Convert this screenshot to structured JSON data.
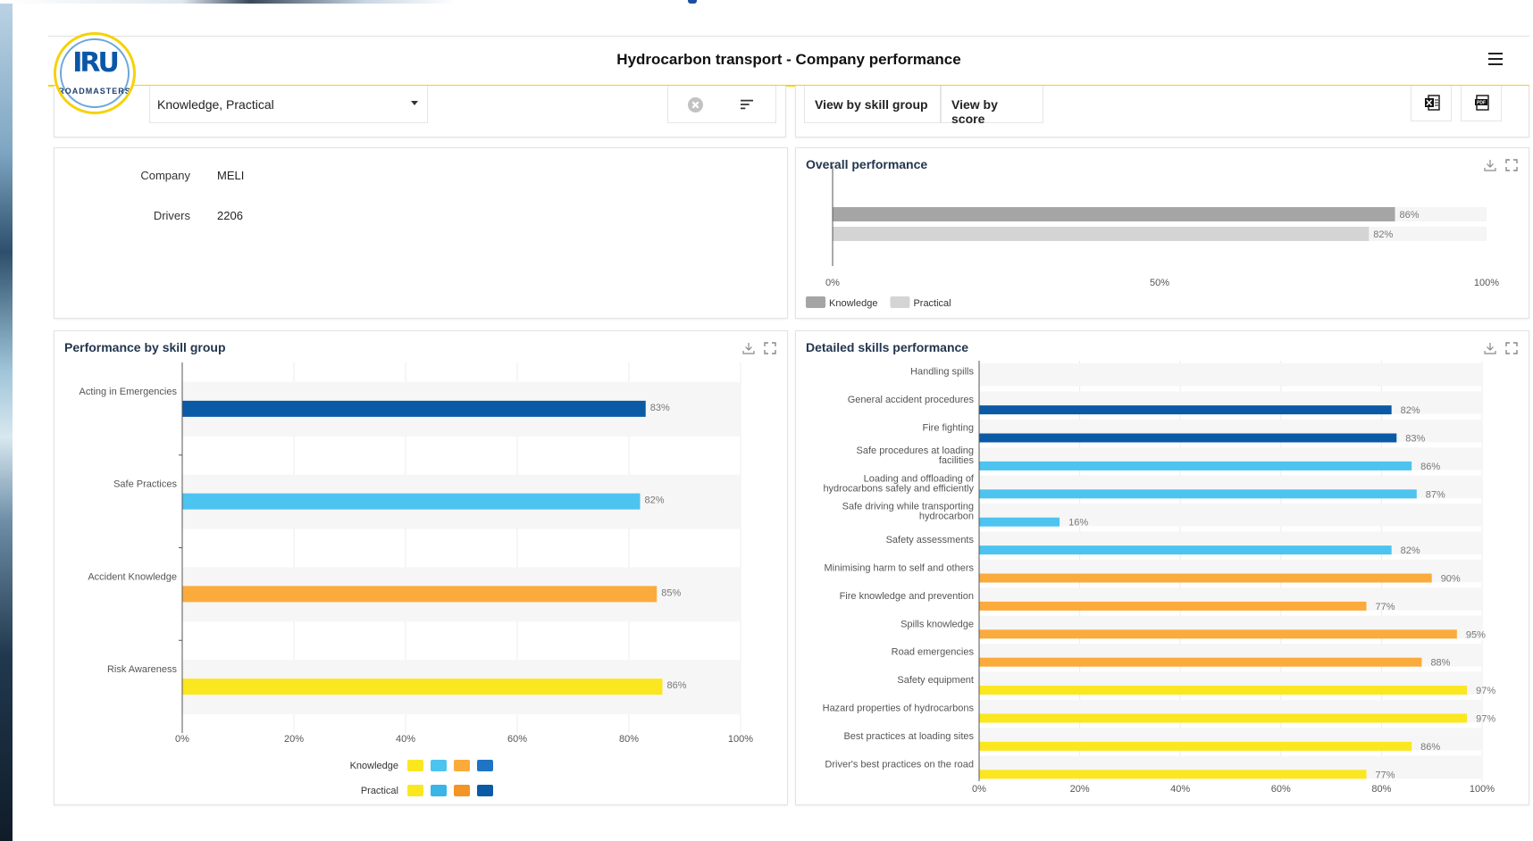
{
  "header": {
    "title": "Hydrocarbon transport - Company performance"
  },
  "logo": {
    "text": "IRU",
    "sub": "ROADMASTERS"
  },
  "filters": {
    "select_value": "Knowledge, Practical",
    "view_by_skill_group": "View by skill group",
    "view_by_score": "View by score",
    "export_xls_icon": "excel-icon",
    "export_pdf_icon": "pdf-icon"
  },
  "info": {
    "company_label": "Company",
    "company_value": "MELI",
    "drivers_label": "Drivers",
    "drivers_value": "2206"
  },
  "overall": {
    "title": "Overall performance",
    "chart_data": {
      "type": "bar",
      "orientation": "horizontal",
      "series": [
        {
          "name": "Knowledge",
          "value": 86,
          "label": "86%",
          "color": "#a5a5a5"
        },
        {
          "name": "Practical",
          "value": 82,
          "label": "82%",
          "color": "#d4d4d4"
        }
      ],
      "ticks": [
        "0%",
        "50%",
        "100%"
      ],
      "xlim": [
        0,
        100
      ]
    }
  },
  "skill_group": {
    "title": "Performance by skill group",
    "chart_data": {
      "type": "bar",
      "orientation": "horizontal",
      "categories": [
        "Acting in Emergencies",
        "Safe Practices",
        "Accident Knowledge",
        "Risk Awareness"
      ],
      "values": [
        83,
        82,
        85,
        86
      ],
      "labels": [
        "83%",
        "82%",
        "85%",
        "86%"
      ],
      "colors": [
        "#0b5aa6",
        "#4cc4ef",
        "#fbab3c",
        "#fbe71f"
      ],
      "ticks": [
        "0%",
        "20%",
        "40%",
        "60%",
        "80%",
        "100%"
      ],
      "xlim": [
        0,
        100
      ],
      "legend": [
        {
          "name": "Knowledge",
          "colors": [
            "#fbe71f",
            "#4cc4ef",
            "#fbab3c",
            "#1f74c6"
          ]
        },
        {
          "name": "Practical",
          "colors": [
            "#fbe71f",
            "#39b5e6",
            "#f39423",
            "#0b5aa6"
          ]
        }
      ]
    }
  },
  "detailed": {
    "title": "Detailed skills performance",
    "chart_data": {
      "type": "bar",
      "orientation": "horizontal",
      "categories": [
        [
          "Handling spills"
        ],
        [
          "General accident procedures"
        ],
        [
          "Fire fighting"
        ],
        [
          "Safe procedures at loading",
          "facilities"
        ],
        [
          "Loading and offloading of",
          "hydrocarbons safely and efficiently"
        ],
        [
          "Safe driving while transporting",
          "hydrocarbon"
        ],
        [
          "Safety assessments"
        ],
        [
          "Minimising harm to self and others"
        ],
        [
          "Fire knowledge and prevention"
        ],
        [
          "Spills knowledge"
        ],
        [
          "Road emergencies"
        ],
        [
          "Safety equipment"
        ],
        [
          "Hazard properties of hydrocarbons"
        ],
        [
          "Best practices at loading sites"
        ],
        [
          "Driver's best practices on the road"
        ]
      ],
      "values": [
        null,
        82,
        83,
        86,
        87,
        16,
        82,
        90,
        77,
        95,
        88,
        97,
        97,
        86,
        77
      ],
      "labels": [
        "",
        "82%",
        "83%",
        "86%",
        "87%",
        "16%",
        "82%",
        "90%",
        "77%",
        "95%",
        "88%",
        "97%",
        "97%",
        "86%",
        "77%"
      ],
      "colors": [
        "#0b5aa6",
        "#0b5aa6",
        "#0b5aa6",
        "#4cc4ef",
        "#4cc4ef",
        "#4cc4ef",
        "#4cc4ef",
        "#fbab3c",
        "#fbab3c",
        "#fbab3c",
        "#fbab3c",
        "#fbe71f",
        "#fbe71f",
        "#fbe71f",
        "#fbe71f"
      ],
      "ticks": [
        "0%",
        "20%",
        "40%",
        "60%",
        "80%",
        "100%"
      ],
      "xlim": [
        0,
        100
      ]
    }
  }
}
